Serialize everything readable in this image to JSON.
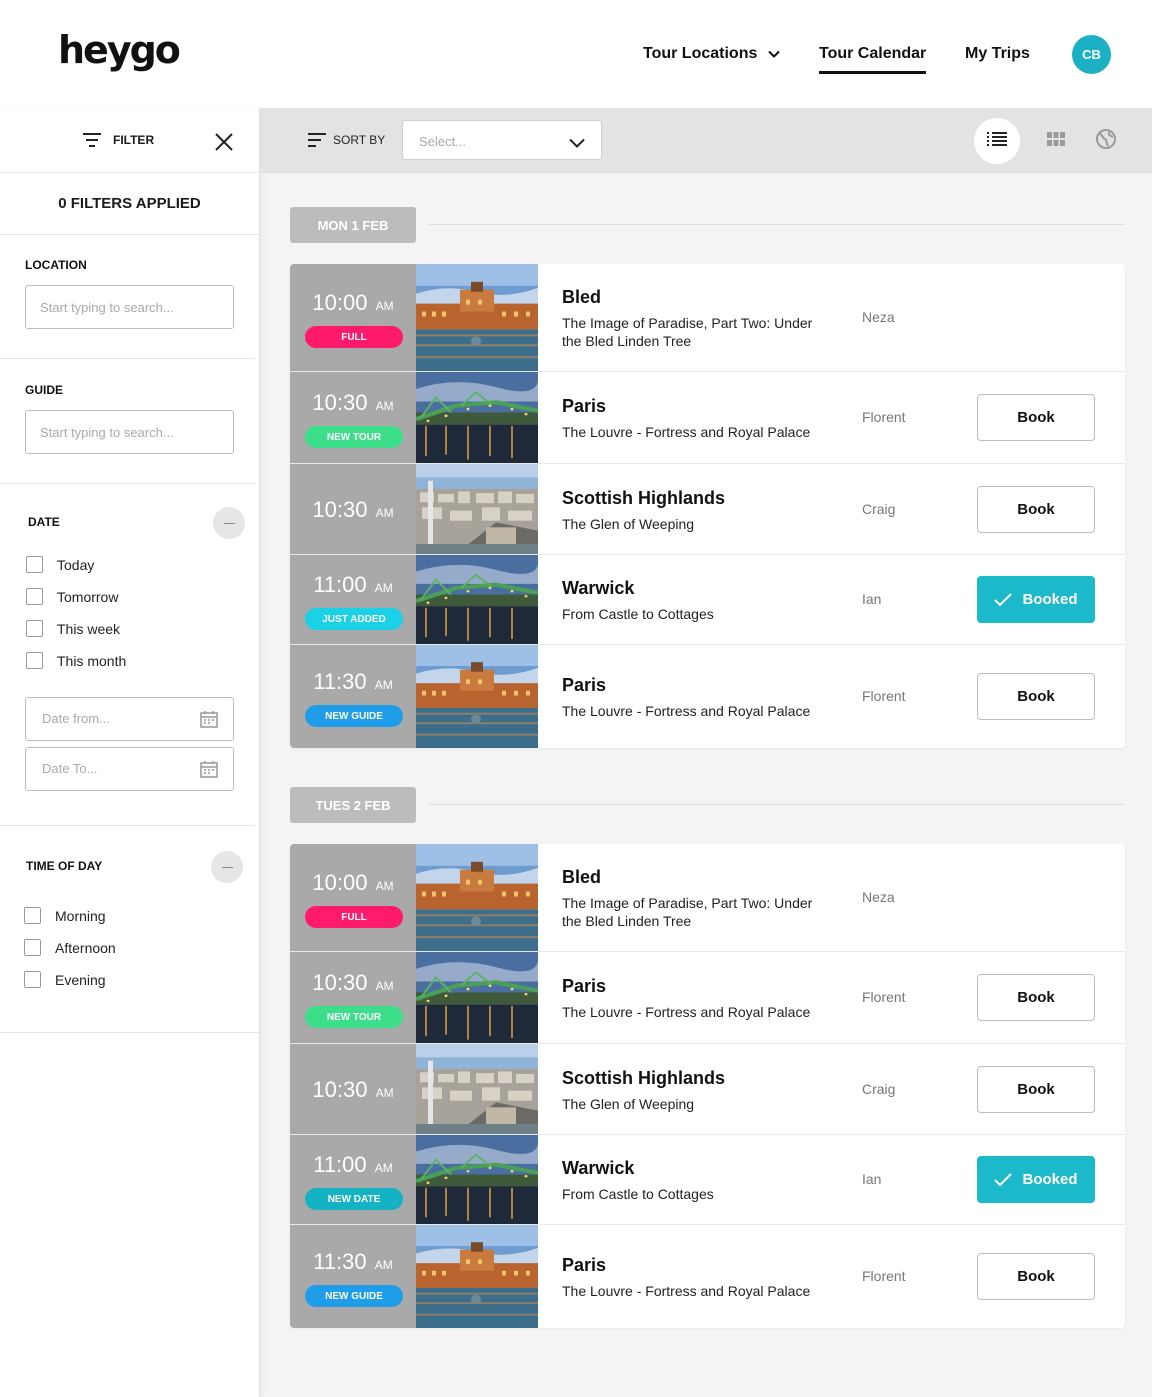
{
  "header": {
    "logo": "heygo",
    "nav": [
      {
        "label": "Tour Locations",
        "active": false,
        "dropdown": true
      },
      {
        "label": "Tour Calendar",
        "active": true,
        "dropdown": false
      },
      {
        "label": "My Trips",
        "active": false,
        "dropdown": false
      }
    ],
    "avatar_initials": "CB",
    "accent_color": "#1bb0c4"
  },
  "sidebar": {
    "filter_label": "FILTER",
    "filters_applied": "0 FILTERS APPLIED",
    "location": {
      "label": "LOCATION",
      "placeholder": "Start typing to search..."
    },
    "guide": {
      "label": "GUIDE",
      "placeholder": "Start typing to search..."
    },
    "date": {
      "label": "DATE",
      "options": [
        "Today",
        "Tomorrow",
        "This week",
        "This month"
      ],
      "from_placeholder": "Date from...",
      "to_placeholder": "Date To..."
    },
    "time_of_day": {
      "label": "TIME OF DAY",
      "options": [
        "Morning",
        "Afternoon",
        "Evening"
      ]
    }
  },
  "toolbar": {
    "sort_label": "SORT BY",
    "sort_placeholder": "Select...",
    "views": [
      "list-view",
      "grid-view",
      "map-view"
    ],
    "active_view": "list-view"
  },
  "days": [
    {
      "label": "MON 1 FEB",
      "tours": [
        {
          "time": "10:00",
          "ampm": "AM",
          "badge": "FULL",
          "badge_color": "#ff1a6b",
          "image": "palace",
          "title": "Bled",
          "subtitle": "The Image of Paradise, Part Two: Under the Bled Linden Tree",
          "guide": "Neza",
          "action": ""
        },
        {
          "time": "10:30",
          "ampm": "AM",
          "badge": "NEW TOUR",
          "badge_color": "#3dde8a",
          "image": "bridge",
          "title": "Paris",
          "subtitle": "The Louvre - Fortress and Royal Palace",
          "guide": "Florent",
          "action": "Book"
        },
        {
          "time": "10:30",
          "ampm": "AM",
          "badge": "",
          "badge_color": "",
          "image": "city",
          "title": "Scottish Highlands",
          "subtitle": "The Glen of Weeping",
          "guide": "Craig",
          "action": "Book"
        },
        {
          "time": "11:00",
          "ampm": "AM",
          "badge": "JUST ADDED",
          "badge_color": "#1bd1e6",
          "image": "bridge",
          "title": "Warwick",
          "subtitle": "From Castle to Cottages",
          "guide": "Ian",
          "action": "Booked"
        },
        {
          "time": "11:30",
          "ampm": "AM",
          "badge": "NEW GUIDE",
          "badge_color": "#1f9de8",
          "image": "palace",
          "title": "Paris",
          "subtitle": "The Louvre - Fortress and Royal Palace",
          "guide": "Florent",
          "action": "Book"
        }
      ]
    },
    {
      "label": "TUES 2 FEB",
      "tours": [
        {
          "time": "10:00",
          "ampm": "AM",
          "badge": "FULL",
          "badge_color": "#ff1a6b",
          "image": "palace",
          "title": "Bled",
          "subtitle": "The Image of Paradise, Part Two: Under the Bled Linden Tree",
          "guide": "Neza",
          "action": ""
        },
        {
          "time": "10:30",
          "ampm": "AM",
          "badge": "NEW TOUR",
          "badge_color": "#3dde8a",
          "image": "bridge",
          "title": "Paris",
          "subtitle": "The Louvre - Fortress and Royal Palace",
          "guide": "Florent",
          "action": "Book"
        },
        {
          "time": "10:30",
          "ampm": "AM",
          "badge": "",
          "badge_color": "",
          "image": "city",
          "title": "Scottish Highlands",
          "subtitle": "The Glen of Weeping",
          "guide": "Craig",
          "action": "Book"
        },
        {
          "time": "11:00",
          "ampm": "AM",
          "badge": "NEW DATE",
          "badge_color": "#14b3c4",
          "image": "bridge",
          "title": "Warwick",
          "subtitle": "From Castle to Cottages",
          "guide": "Ian",
          "action": "Booked"
        },
        {
          "time": "11:30",
          "ampm": "AM",
          "badge": "NEW GUIDE",
          "badge_color": "#1f9de8",
          "image": "palace",
          "title": "Paris",
          "subtitle": "The Louvre - Fortress and Royal Palace",
          "guide": "Florent",
          "action": "Book"
        }
      ]
    }
  ]
}
